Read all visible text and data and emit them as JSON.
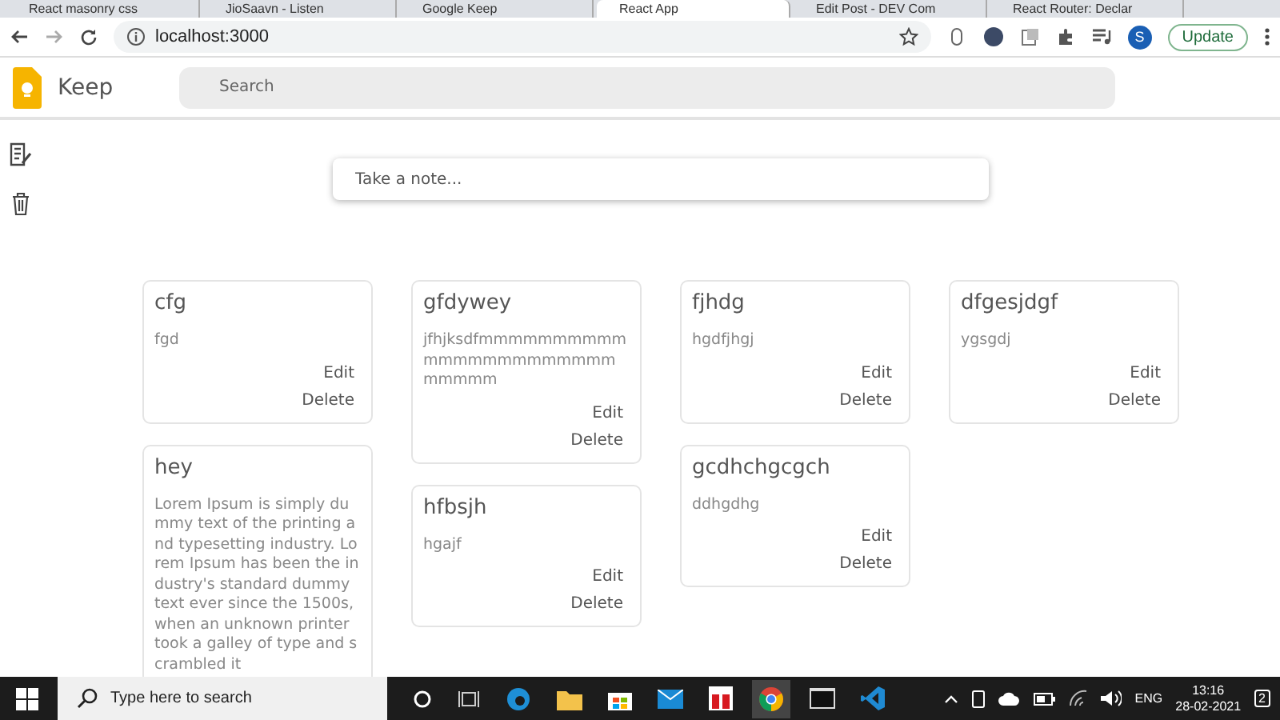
{
  "browser": {
    "tabs": [
      {
        "title": "React masonry css",
        "selected": false
      },
      {
        "title": "JioSaavn - Listen",
        "selected": false
      },
      {
        "title": "Google Keep",
        "selected": false
      },
      {
        "title": "React App",
        "selected": true
      },
      {
        "title": "Edit Post - DEV Com",
        "selected": false
      },
      {
        "title": "React Router: Declar",
        "selected": false
      }
    ],
    "url": "localhost:3000",
    "profile": "S",
    "update_button": "Update"
  },
  "app": {
    "title": "Keep",
    "search": {
      "placeholder": "Search"
    },
    "composer": {
      "placeholder": "Take a note..."
    }
  },
  "notes": [
    {
      "title": "cfg",
      "body": "fgd",
      "edit": "Edit",
      "delete": "Delete"
    },
    {
      "title": "gfdywey",
      "body": "jfhjksdfmmmmmmmmmmmmmmmmmmmmmmmmmmmm",
      "edit": "Edit",
      "delete": "Delete"
    },
    {
      "title": "fjhdg",
      "body": "hgdfjhgj",
      "edit": "Edit",
      "delete": "Delete"
    },
    {
      "title": "dfgesjdgf",
      "body": "ygsgdj",
      "edit": "Edit",
      "delete": "Delete"
    },
    {
      "title": "hey",
      "body": "Lorem Ipsum is simply dummy text of the printing and typesetting industry. Lorem Ipsum has been the industry's standard dummy text ever since the 1500s, when an unknown printer took a galley of type and scrambled it"
    },
    {
      "title": "hfbsjh",
      "body": "hgajf",
      "edit": "Edit",
      "delete": "Delete"
    },
    {
      "title": "gcdhchgcgch",
      "body": "ddhgdhg",
      "edit": "Edit",
      "delete": "Delete"
    }
  ],
  "taskbar": {
    "search_placeholder": "Type here to search",
    "language": "ENG",
    "time": "13:16",
    "date": "28-02-2021",
    "notification_count": "2"
  }
}
